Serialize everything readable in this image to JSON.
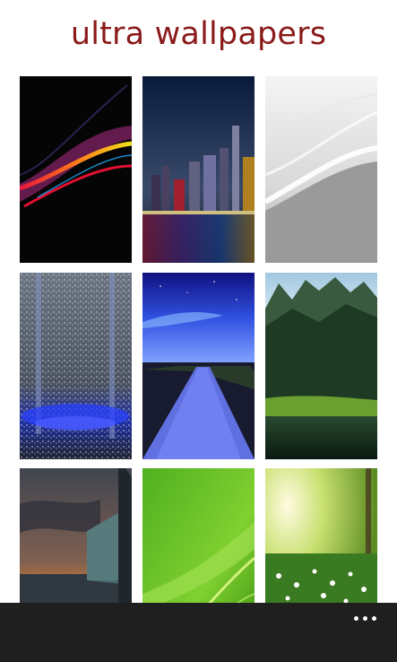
{
  "app": {
    "title": "ultra wallpapers",
    "title_color": "#8b1a1a"
  },
  "grid": {
    "tiles": [
      {
        "name": "wallpaper-abstract-light-streaks"
      },
      {
        "name": "wallpaper-city-skyline-night"
      },
      {
        "name": "wallpaper-silver-waves"
      },
      {
        "name": "wallpaper-blue-water-splash"
      },
      {
        "name": "wallpaper-blue-road-night-sky"
      },
      {
        "name": "wallpaper-mountain-lake"
      },
      {
        "name": "wallpaper-sunset-glass-building"
      },
      {
        "name": "wallpaper-green-waves"
      },
      {
        "name": "wallpaper-sunlit-meadow-flowers"
      }
    ]
  },
  "app_bar": {
    "background": "#1f1f1f",
    "more_icon": "more-ellipsis-icon"
  }
}
